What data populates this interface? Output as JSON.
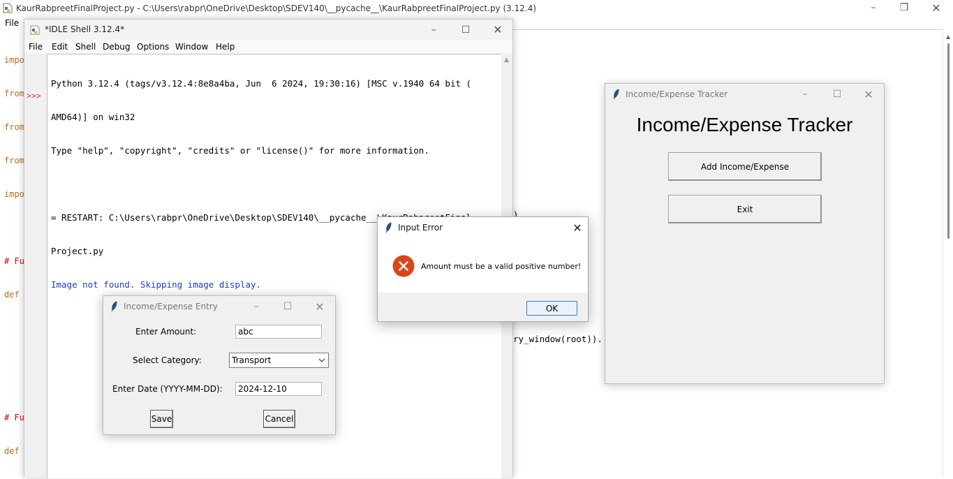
{
  "editor": {
    "title": "KaurRabpreetFinalProject.py - C:\\Users\\rabpr\\OneDrive\\Desktop\\SDEV140\\__pycache__\\KaurRabpreetFinalProject.py (3.12.4)",
    "menu_file": "File",
    "code_lines": [
      "impo",
      "from",
      "from",
      "from",
      "impo",
      "",
      "# Fu",
      "def"
    ],
    "code_lines_lower": [
      "# Fu",
      "def"
    ],
    "partial_text_1": ")",
    "partial_text_2": "ry_window(root))."
  },
  "shell": {
    "title": "*IDLE Shell 3.12.4*",
    "menu": [
      "File",
      "Edit",
      "Shell",
      "Debug",
      "Options",
      "Window",
      "Help"
    ],
    "prompt": ">>>",
    "lines": [
      "Python 3.12.4 (tags/v3.12.4:8e8a4ba, Jun  6 2024, 19:30:16) [MSC v.1940 64 bit (",
      "AMD64)] on win32",
      "Type \"help\", \"copyright\", \"credits\" or \"license()\" for more information.",
      "",
      "= RESTART: C:\\Users\\rabpr\\OneDrive\\Desktop\\SDEV140\\__pycache__\\KaurRabpreetFinal",
      "Project.py"
    ],
    "output_line": "Image not found. Skipping image display."
  },
  "tracker": {
    "window_title": "Income/Expense Tracker",
    "heading": "Income/Expense Tracker",
    "add_button": "Add Income/Expense",
    "exit_button": "Exit"
  },
  "entry": {
    "window_title": "Income/Expense Entry",
    "amount_label": "Enter Amount:",
    "amount_value": "abc",
    "category_label": "Select Category:",
    "category_value": "Transport",
    "date_label": "Enter Date (YYYY-MM-DD):",
    "date_value": "2024-12-10",
    "save_button": "Save",
    "cancel_button": "Cancel"
  },
  "error": {
    "window_title": "Input Error",
    "message": "Amount must be a valid positive number!",
    "ok_button": "OK"
  },
  "colors": {
    "keyword": "#c26a1e",
    "comment": "#dd0000",
    "output_blue": "#1f3fbf",
    "prompt_red": "#c0392b",
    "error_icon": "#d9461b"
  }
}
